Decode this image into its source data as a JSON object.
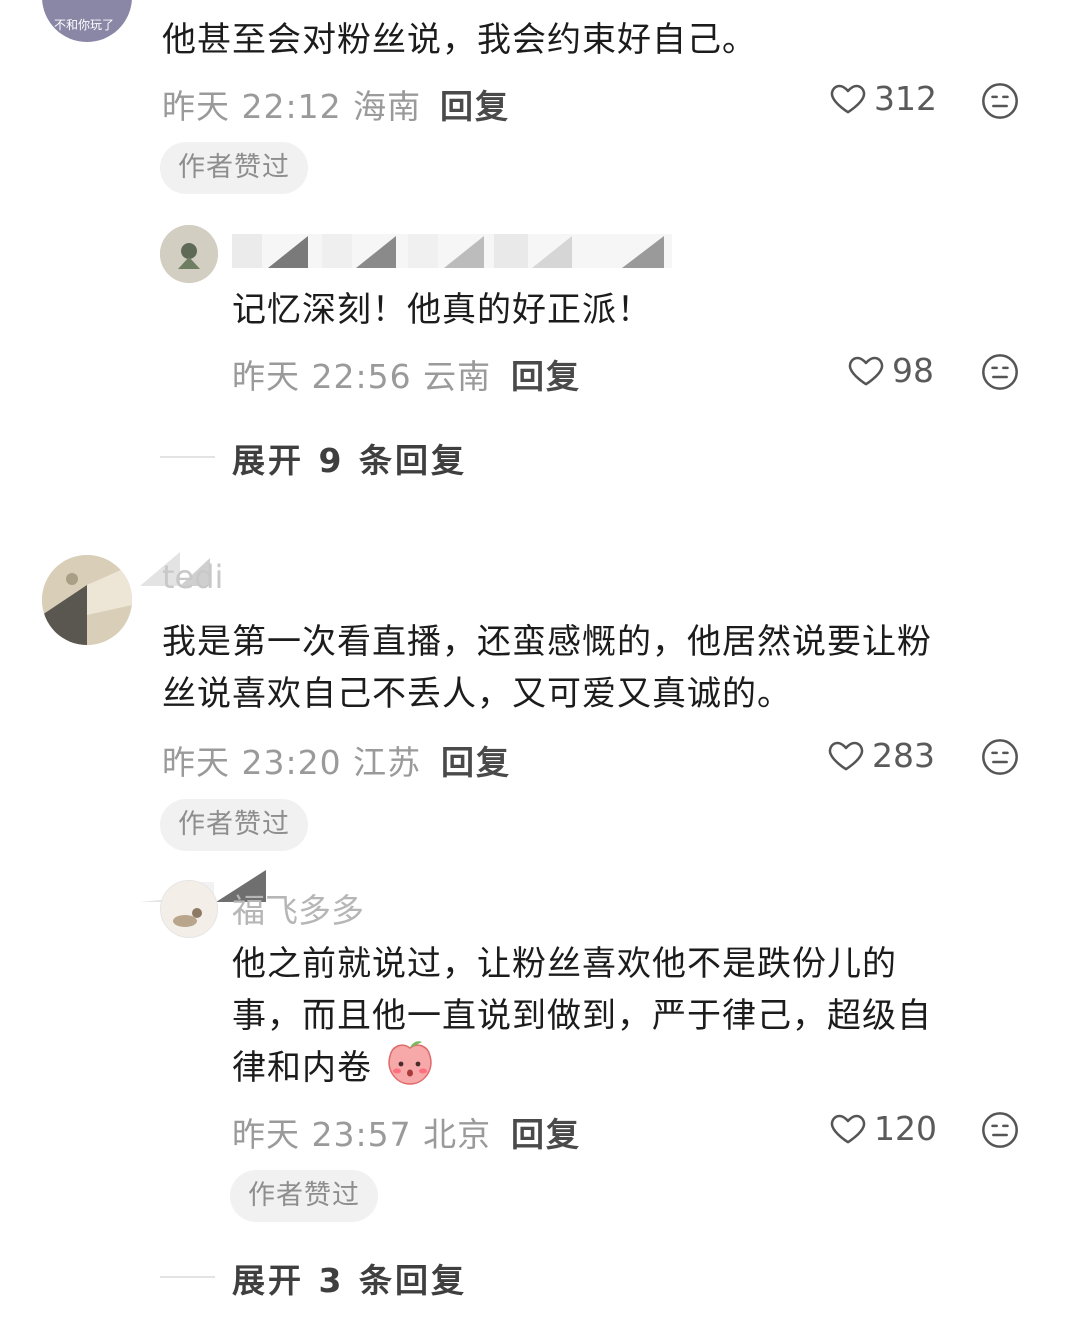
{
  "comments": [
    {
      "avatar_caption": "不和你玩了",
      "text": "他甚至会对粉丝说，我会约束好自己。",
      "time_location": "昨天 22:12 海南",
      "reply_label": "回复",
      "likes": "312",
      "badge": "作者赞过",
      "replies": [
        {
          "text": "记忆深刻！他真的好正派！",
          "time_location": "昨天 22:56 云南",
          "reply_label": "回复",
          "likes": "98"
        }
      ],
      "expand_label": "展开 9 条回复"
    },
    {
      "name": "tedi",
      "text_line1": "我是第一次看直播，还蛮感慨的，他居然说要让粉",
      "text_line2": "丝说喜欢自己不丢人，又可爱又真诚的。",
      "time_location": "昨天 23:20 江苏",
      "reply_label": "回复",
      "likes": "283",
      "badge": "作者赞过",
      "replies": [
        {
          "name": "福飞多多",
          "text_line1": "他之前就说过，让粉丝喜欢他不是跌份儿的",
          "text_line2": "事，而且他一直说到做到，严于律己，超级自",
          "text_line3": "律和内卷",
          "time_location": "昨天 23:57 北京",
          "reply_label": "回复",
          "likes": "120",
          "badge": "作者赞过"
        }
      ],
      "expand_label": "展开 3 条回复"
    }
  ],
  "icons": {
    "like": "heart-outline-icon",
    "emoji": "neutral-face-icon",
    "sticker": "blushing-peach-emoji"
  },
  "colors": {
    "meta_gray": "#9a9a9a",
    "badge_bg": "#f1f1f1",
    "text": "#1c1c1c"
  }
}
